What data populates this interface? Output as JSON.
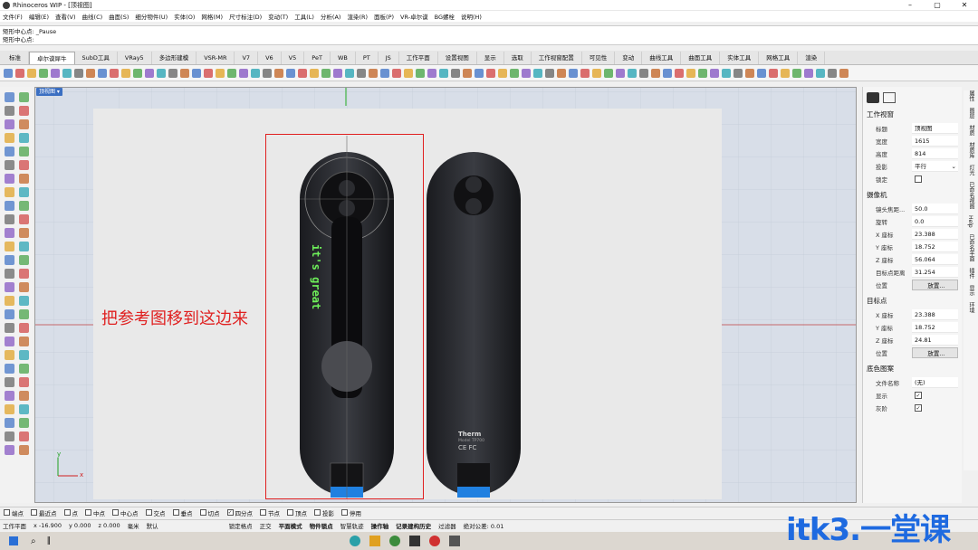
{
  "window": {
    "title": "Rhinoceros WIP - [顶视图]"
  },
  "menu": [
    "文件(F)",
    "编辑(E)",
    "查看(V)",
    "曲线(C)",
    "曲面(S)",
    "细分物件(U)",
    "实体(O)",
    "网格(M)",
    "尺寸标注(D)",
    "变动(T)",
    "工具(L)",
    "分析(A)",
    "渲染(R)",
    "面板(P)",
    "VR-卓尔谟",
    "BG螺栓",
    "说明(H)"
  ],
  "command": {
    "history": "矩形中心点: _Pause",
    "prompt": "矩形中心点:"
  },
  "tabs": [
    "标准",
    "卓尔谟犀牛",
    "SubD工具",
    "VRay5",
    "多边形建模",
    "VSR-MR",
    "V7",
    "V6",
    "V5",
    "PeT",
    "WB",
    "PT",
    "JS",
    "工作平面",
    "设置视图",
    "显示",
    "选取",
    "工作视窗配置",
    "可见性",
    "变动",
    "曲线工具",
    "曲面工具",
    "实体工具",
    "网格工具",
    "渲染"
  ],
  "active_tab": 1,
  "viewport": {
    "label": "顶视图",
    "annotation": "把参考图移到这边来",
    "product_text": "it's great",
    "brand": "Therm",
    "model": "Model TP700",
    "cert": "CE FC",
    "axis_y": "y",
    "axis_x": "x"
  },
  "panel": {
    "section1": "工作视窗",
    "title_label": "标题",
    "title_value": "顶视图",
    "width_label": "宽度",
    "width_value": "1615",
    "height_label": "高度",
    "height_value": "814",
    "proj_label": "投影",
    "proj_value": "平行",
    "lock_label": "锁定",
    "section2": "摄像机",
    "lens_label": "镜头焦距...",
    "lens_value": "50.0",
    "rot_label": "旋转",
    "rot_value": "0.0",
    "cx_label": "X 座标",
    "cx_value": "23.388",
    "cy_label": "Y 座标",
    "cy_value": "18.752",
    "cz_label": "Z 座标",
    "cz_value": "56.064",
    "dist_label": "目标点距离",
    "dist_value": "31.254",
    "pos_label": "位置",
    "pos_btn": "放置...",
    "section3": "目标点",
    "tx_label": "X 座标",
    "tx_value": "23.388",
    "ty_label": "Y 座标",
    "ty_value": "18.752",
    "tz_label": "Z 座标",
    "tz_value": "24.81",
    "tpos_label": "位置",
    "tpos_btn": "放置...",
    "section4": "底色图案",
    "file_label": "文件名称",
    "file_value": "(无)",
    "show_label": "显示",
    "gray_label": "灰阶"
  },
  "sidetabs": [
    "属性",
    "图层",
    "材质",
    "材质库",
    "灯光",
    "已命名视图",
    "Help",
    "已命名平面",
    "插件",
    "显示",
    "环境"
  ],
  "osnap": [
    "端点",
    "最近点",
    "点",
    "中点",
    "中心点",
    "交点",
    "垂点",
    "切点",
    "四分点",
    "节点",
    "顶点",
    "投影",
    "停用"
  ],
  "status": {
    "cplane": "工作平面",
    "x": "x -16.900",
    "y": "y 0.000",
    "z": "z 0.000",
    "unit": "毫米",
    "layer": "默认",
    "grid_snap": "锁定格点",
    "ortho": "正交",
    "planar": "平面模式",
    "osnap": "物件锁点",
    "smarttrack": "智慧轨迹",
    "gumball": "操作轴",
    "history": "记录建构历史",
    "filter": "过滤器",
    "tol": "绝对公差: 0.01"
  },
  "watermark": "itk3.一堂课"
}
